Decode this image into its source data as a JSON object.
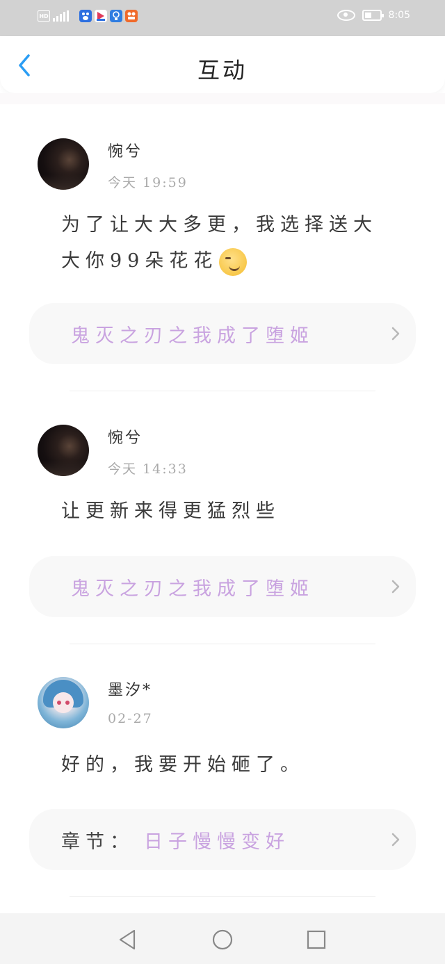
{
  "status_bar": {
    "hd_label": "HD",
    "network_label": "4G",
    "time": "8:05",
    "apps": [
      {
        "icon": "baidu-icon",
        "color": "#2d6fe0"
      },
      {
        "icon": "video-app-icon",
        "color": "#e03a5a"
      },
      {
        "icon": "lightbulb-app-icon",
        "color": "#2f7de1"
      },
      {
        "icon": "game-app-icon",
        "color": "#f06a2a"
      }
    ]
  },
  "header": {
    "title": "互动",
    "back_icon": "chevron-left-icon",
    "accent_color": "#2a9df4"
  },
  "posts": [
    {
      "username": "惋兮",
      "time": "今天 19:59",
      "body": "为了让大大多更，我选择送大大你99朵花花",
      "emoji": "smirk-emoji",
      "link_prefix": "",
      "link_text": "鬼灭之刃之我成了堕姬"
    },
    {
      "username": "惋兮",
      "time": "今天 14:33",
      "body": "让更新来得更猛烈些",
      "link_prefix": "",
      "link_text": "鬼灭之刃之我成了堕姬"
    },
    {
      "username": "墨汐*",
      "time": "02-27",
      "body": "好的，我要开始砸了。",
      "link_prefix": "章节：",
      "link_text": "日子慢慢变好"
    }
  ],
  "colors": {
    "link_text": "#c9a3e0",
    "card_bg": "#f8f8f8",
    "status_bar_bg": "#d2d2d2"
  }
}
